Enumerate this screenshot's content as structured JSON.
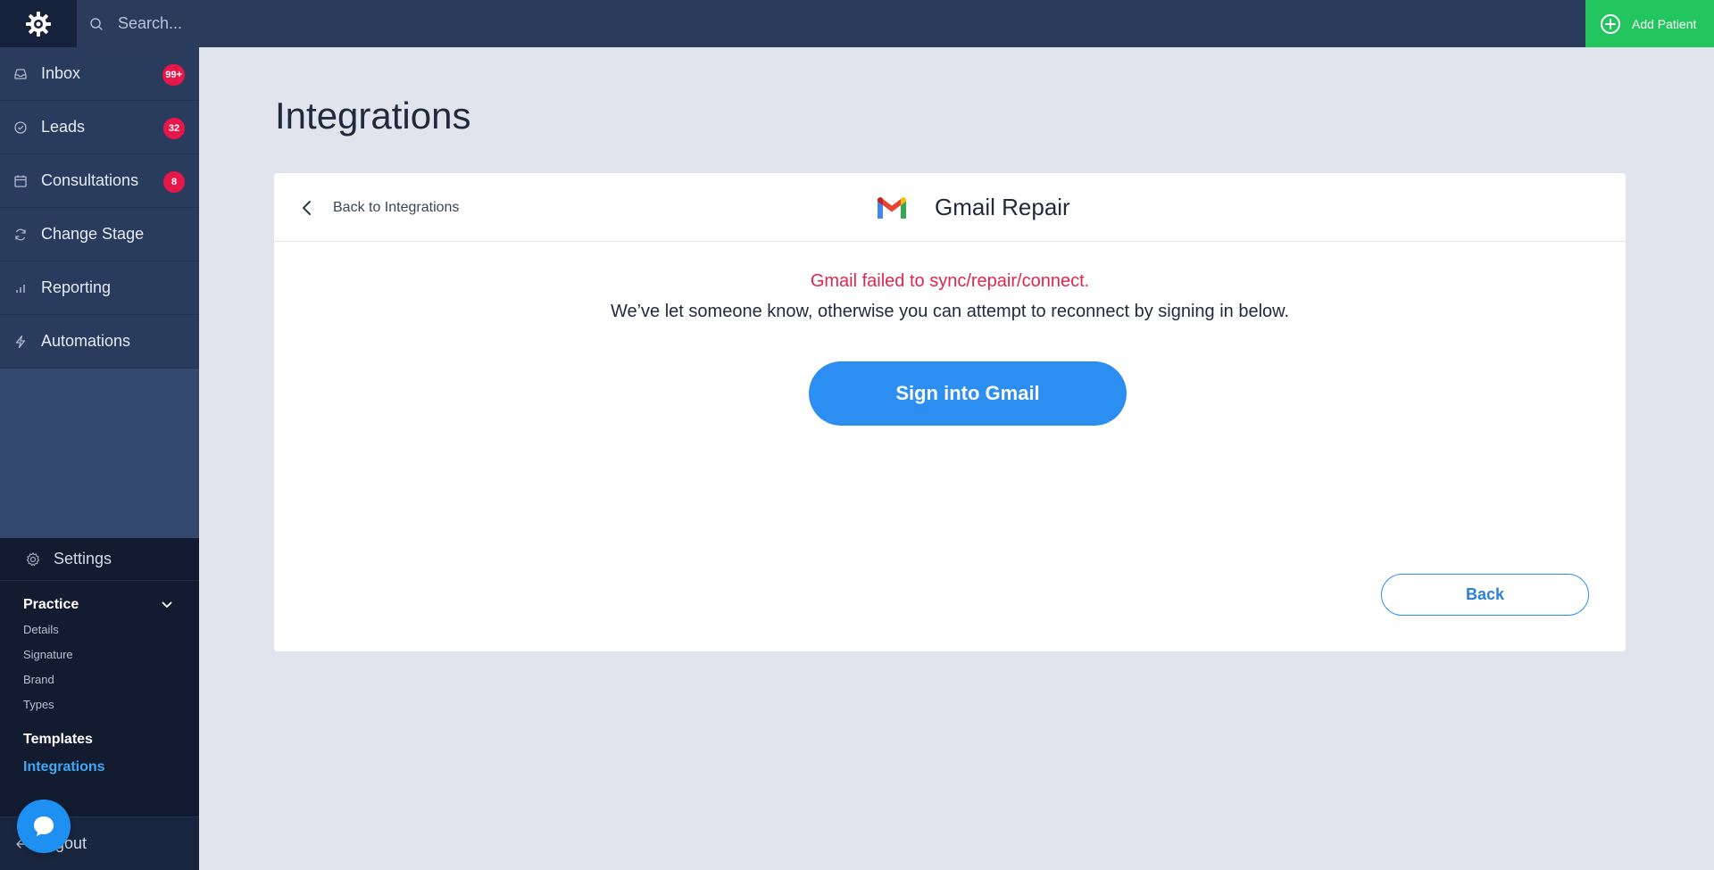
{
  "topbar": {
    "search_placeholder": "Search...",
    "add_patient_label": "Add Patient"
  },
  "sidebar": {
    "items": [
      {
        "label": "Inbox",
        "icon": "inbox-icon",
        "badge": "99+"
      },
      {
        "label": "Leads",
        "icon": "check-circle-icon",
        "badge": "32"
      },
      {
        "label": "Consultations",
        "icon": "calendar-icon",
        "badge": "8"
      },
      {
        "label": "Change Stage",
        "icon": "refresh-icon",
        "badge": null
      },
      {
        "label": "Reporting",
        "icon": "bar-chart-icon",
        "badge": null
      },
      {
        "label": "Automations",
        "icon": "lightning-icon",
        "badge": null
      }
    ],
    "settings_label": "Settings",
    "practice_label": "Practice",
    "practice_items": [
      "Details",
      "Signature",
      "Brand",
      "Types"
    ],
    "templates_label": "Templates",
    "integrations_label": "Integrations",
    "logout_label": "Logout"
  },
  "main": {
    "page_title": "Integrations",
    "card": {
      "back_link": "Back to Integrations",
      "title": "Gmail Repair",
      "error_message": "Gmail failed to sync/repair/connect.",
      "info_message": "We’ve let someone know, otherwise you can attempt to reconnect by signing in below.",
      "sign_in_button": "Sign into Gmail",
      "back_button": "Back"
    }
  },
  "colors": {
    "topbar": "#2a3b5c",
    "accent_green": "#22c55e",
    "badge_red": "#e8174a",
    "primary_blue": "#2c8ef0",
    "error_red": "#e0254e",
    "active_link": "#3fa9f5"
  }
}
